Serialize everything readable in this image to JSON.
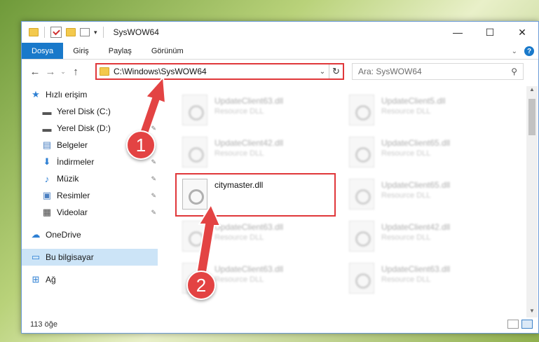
{
  "window": {
    "title": "SysWOW64"
  },
  "ribbon": {
    "tabs": [
      "Dosya",
      "Giriş",
      "Paylaş",
      "Görünüm"
    ],
    "help_label": "?"
  },
  "nav": {
    "address": "C:\\Windows\\SysWOW64",
    "search_placeholder": "Ara: SysWOW64"
  },
  "sidebar": {
    "items": [
      {
        "label": "Hızlı erişim",
        "icon": "star-icon",
        "top": true
      },
      {
        "label": "Yerel Disk (C:)",
        "icon": "drive-icon",
        "pin": true
      },
      {
        "label": "Yerel Disk (D:)",
        "icon": "drive-icon",
        "pin": true
      },
      {
        "label": "Belgeler",
        "icon": "document-icon",
        "pin": true
      },
      {
        "label": "İndirmeler",
        "icon": "download-icon",
        "pin": true
      },
      {
        "label": "Müzik",
        "icon": "music-icon",
        "pin": true
      },
      {
        "label": "Resimler",
        "icon": "pictures-icon",
        "pin": true
      },
      {
        "label": "Videolar",
        "icon": "video-icon",
        "pin": true
      },
      {
        "label": "OneDrive",
        "icon": "cloud-icon",
        "top": true
      },
      {
        "label": "Bu bilgisayar",
        "icon": "computer-icon",
        "top": true,
        "selected": true
      },
      {
        "label": "Ağ",
        "icon": "network-icon",
        "top": true
      }
    ]
  },
  "files": [
    {
      "name": "UpdateClient63.dll",
      "type": "Resource DLL"
    },
    {
      "name": "UpdateClient5.dll",
      "type": "Resource DLL"
    },
    {
      "name": "UpdateClient42.dll",
      "type": "Resource DLL"
    },
    {
      "name": "UpdateClient65.dll",
      "type": "Resource DLL"
    },
    {
      "name": "citymaster.dll",
      "type": ""
    },
    {
      "name": "UpdateClient65.dll",
      "type": "Resource DLL"
    },
    {
      "name": "UpdateClient63.dll",
      "type": "Resource DLL"
    },
    {
      "name": "UpdateClient42.dll",
      "type": "Resource DLL"
    },
    {
      "name": "UpdateClient63.dll",
      "type": "Resource DLL"
    },
    {
      "name": "UpdateClient63.dll",
      "type": "Resource DLL"
    }
  ],
  "status": {
    "item_count": "113 öğe"
  },
  "callouts": [
    "1",
    "2"
  ],
  "colors": {
    "accent": "#1979ca",
    "highlight": "#e0373a",
    "callout": "#e34343"
  }
}
